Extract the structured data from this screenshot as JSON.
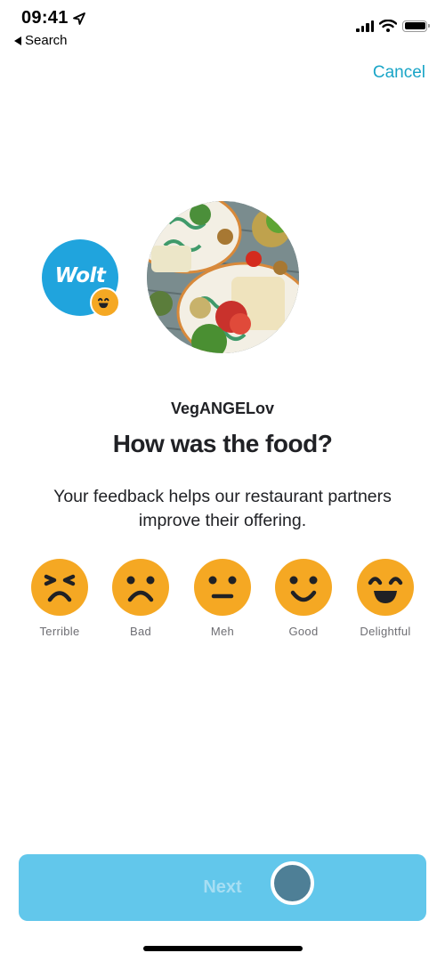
{
  "status_bar": {
    "time": "09:41",
    "back_app_label": "Search",
    "icons": [
      "location-arrow-icon",
      "cellular-signal-icon",
      "wifi-icon",
      "battery-icon"
    ]
  },
  "header": {
    "cancel_label": "Cancel"
  },
  "brand": {
    "logo_text": "Wolt",
    "badge_icon": "grinning-face-icon",
    "accent_color": "#20a4dd"
  },
  "venue": {
    "name": "VegANGELov",
    "photo_alt": "Restaurant food photo"
  },
  "main": {
    "question": "How was the food?",
    "subtitle": "Your feedback helps our restaurant partners improve their offering."
  },
  "ratings": {
    "face_color": "#f5a823",
    "options": [
      {
        "label": "Terrible",
        "icon": "terrible-face-icon"
      },
      {
        "label": "Bad",
        "icon": "bad-face-icon"
      },
      {
        "label": "Meh",
        "icon": "meh-face-icon"
      },
      {
        "label": "Good",
        "icon": "good-face-icon"
      },
      {
        "label": "Delightful",
        "icon": "delightful-face-icon"
      }
    ]
  },
  "footer": {
    "next_label": "Next",
    "next_enabled": false
  }
}
